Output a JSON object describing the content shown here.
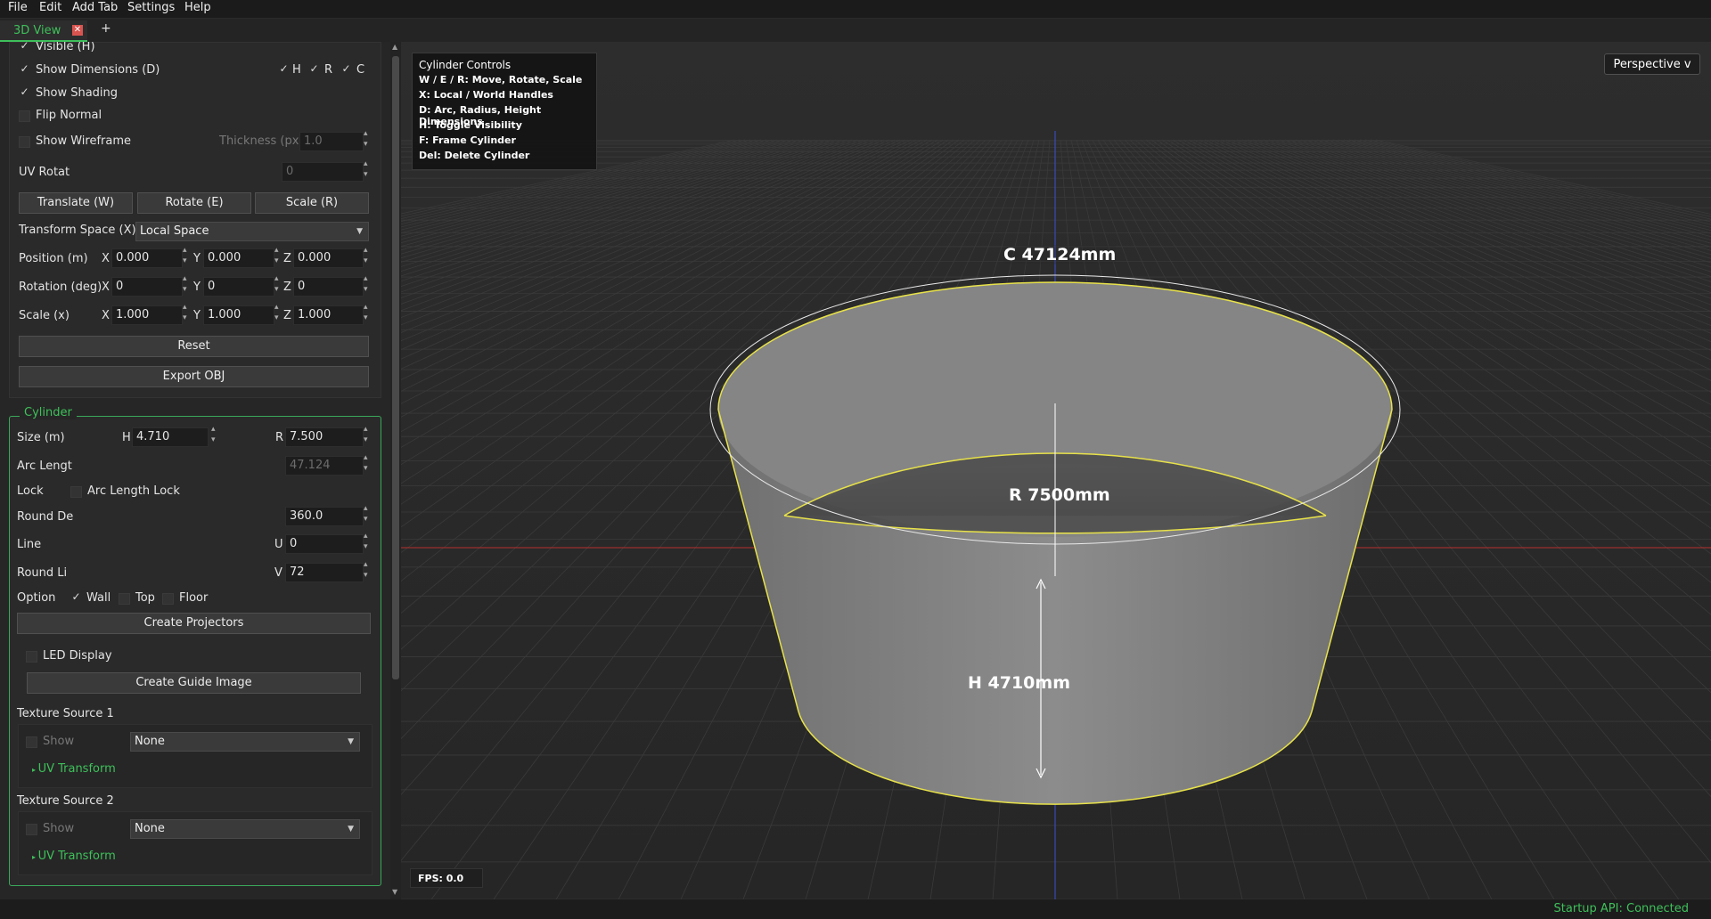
{
  "menu": [
    "File",
    "Edit",
    "Add Tab",
    "Settings",
    "Help"
  ],
  "tabs": {
    "active": "3D View",
    "add": "+"
  },
  "display": {
    "visible": "Visible (H)",
    "show_dimensions": "Show Dimensions (D)",
    "dim_h": "H",
    "dim_r": "R",
    "dim_c": "C",
    "show_shading": "Show Shading",
    "flip_normal": "Flip Normal",
    "show_wireframe": "Show Wireframe",
    "thickness_label": "Thickness (px)",
    "thickness_value": "1.0",
    "uv_rotat": "UV Rotat",
    "uv_rotat_value": "0"
  },
  "transform": {
    "translate": "Translate (W)",
    "rotate": "Rotate (E)",
    "scale": "Scale (R)",
    "space_label": "Transform Space (X)",
    "space_value": "Local Space",
    "position_label": "Position (m)",
    "rotation_label": "Rotation (deg)",
    "scale_label": "Scale (x)",
    "x": "X",
    "y": "Y",
    "z": "Z",
    "pos": [
      "0.000",
      "0.000",
      "0.000"
    ],
    "rot": [
      "0",
      "0",
      "0"
    ],
    "scl": [
      "1.000",
      "1.000",
      "1.000"
    ],
    "reset": "Reset",
    "export": "Export OBJ"
  },
  "cylinder": {
    "title": "Cylinder",
    "size_label": "Size (m)",
    "h": "H",
    "h_value": "4.710",
    "r": "R",
    "r_value": "7.500",
    "arc_label": "Arc Lengt",
    "arc_value": "47.124",
    "lock_label": "Lock",
    "arc_lock": "Arc Length Lock",
    "round_d_label": "Round De",
    "round_d_value": "360.0",
    "line_label": "Line",
    "u": "U",
    "u_value": "0",
    "round_li_label": "Round Li",
    "v": "V",
    "v_value": "72",
    "option_label": "Option",
    "wall": "Wall",
    "top": "Top",
    "floor": "Floor",
    "create_projectors": "Create Projectors",
    "led_display": "LED Display",
    "create_guide": "Create Guide Image",
    "tex1_label": "Texture Source 1",
    "tex2_label": "Texture Source 2",
    "show": "Show",
    "none": "None",
    "uv_transform": "UV Transform"
  },
  "viewport": {
    "controls_title": "Cylinder Controls",
    "controls": [
      "W / E / R: Move, Rotate, Scale",
      "X: Local / World Handles",
      "D: Arc, Radius, Height Dimensions",
      "H: Toggle Visibility",
      "F: Frame Cylinder",
      "Del: Delete Cylinder"
    ],
    "perspective": "Perspective v",
    "label_c": "C 47124mm",
    "label_r": "R 7500mm",
    "label_h": "H 4710mm",
    "fps": "FPS: 0.0"
  },
  "status": "Startup API: Connected",
  "colors": {
    "accent": "#3ec05a",
    "outline": "#e8e24a",
    "axis_x": "#c83232",
    "axis_z": "#3a4fd0"
  }
}
